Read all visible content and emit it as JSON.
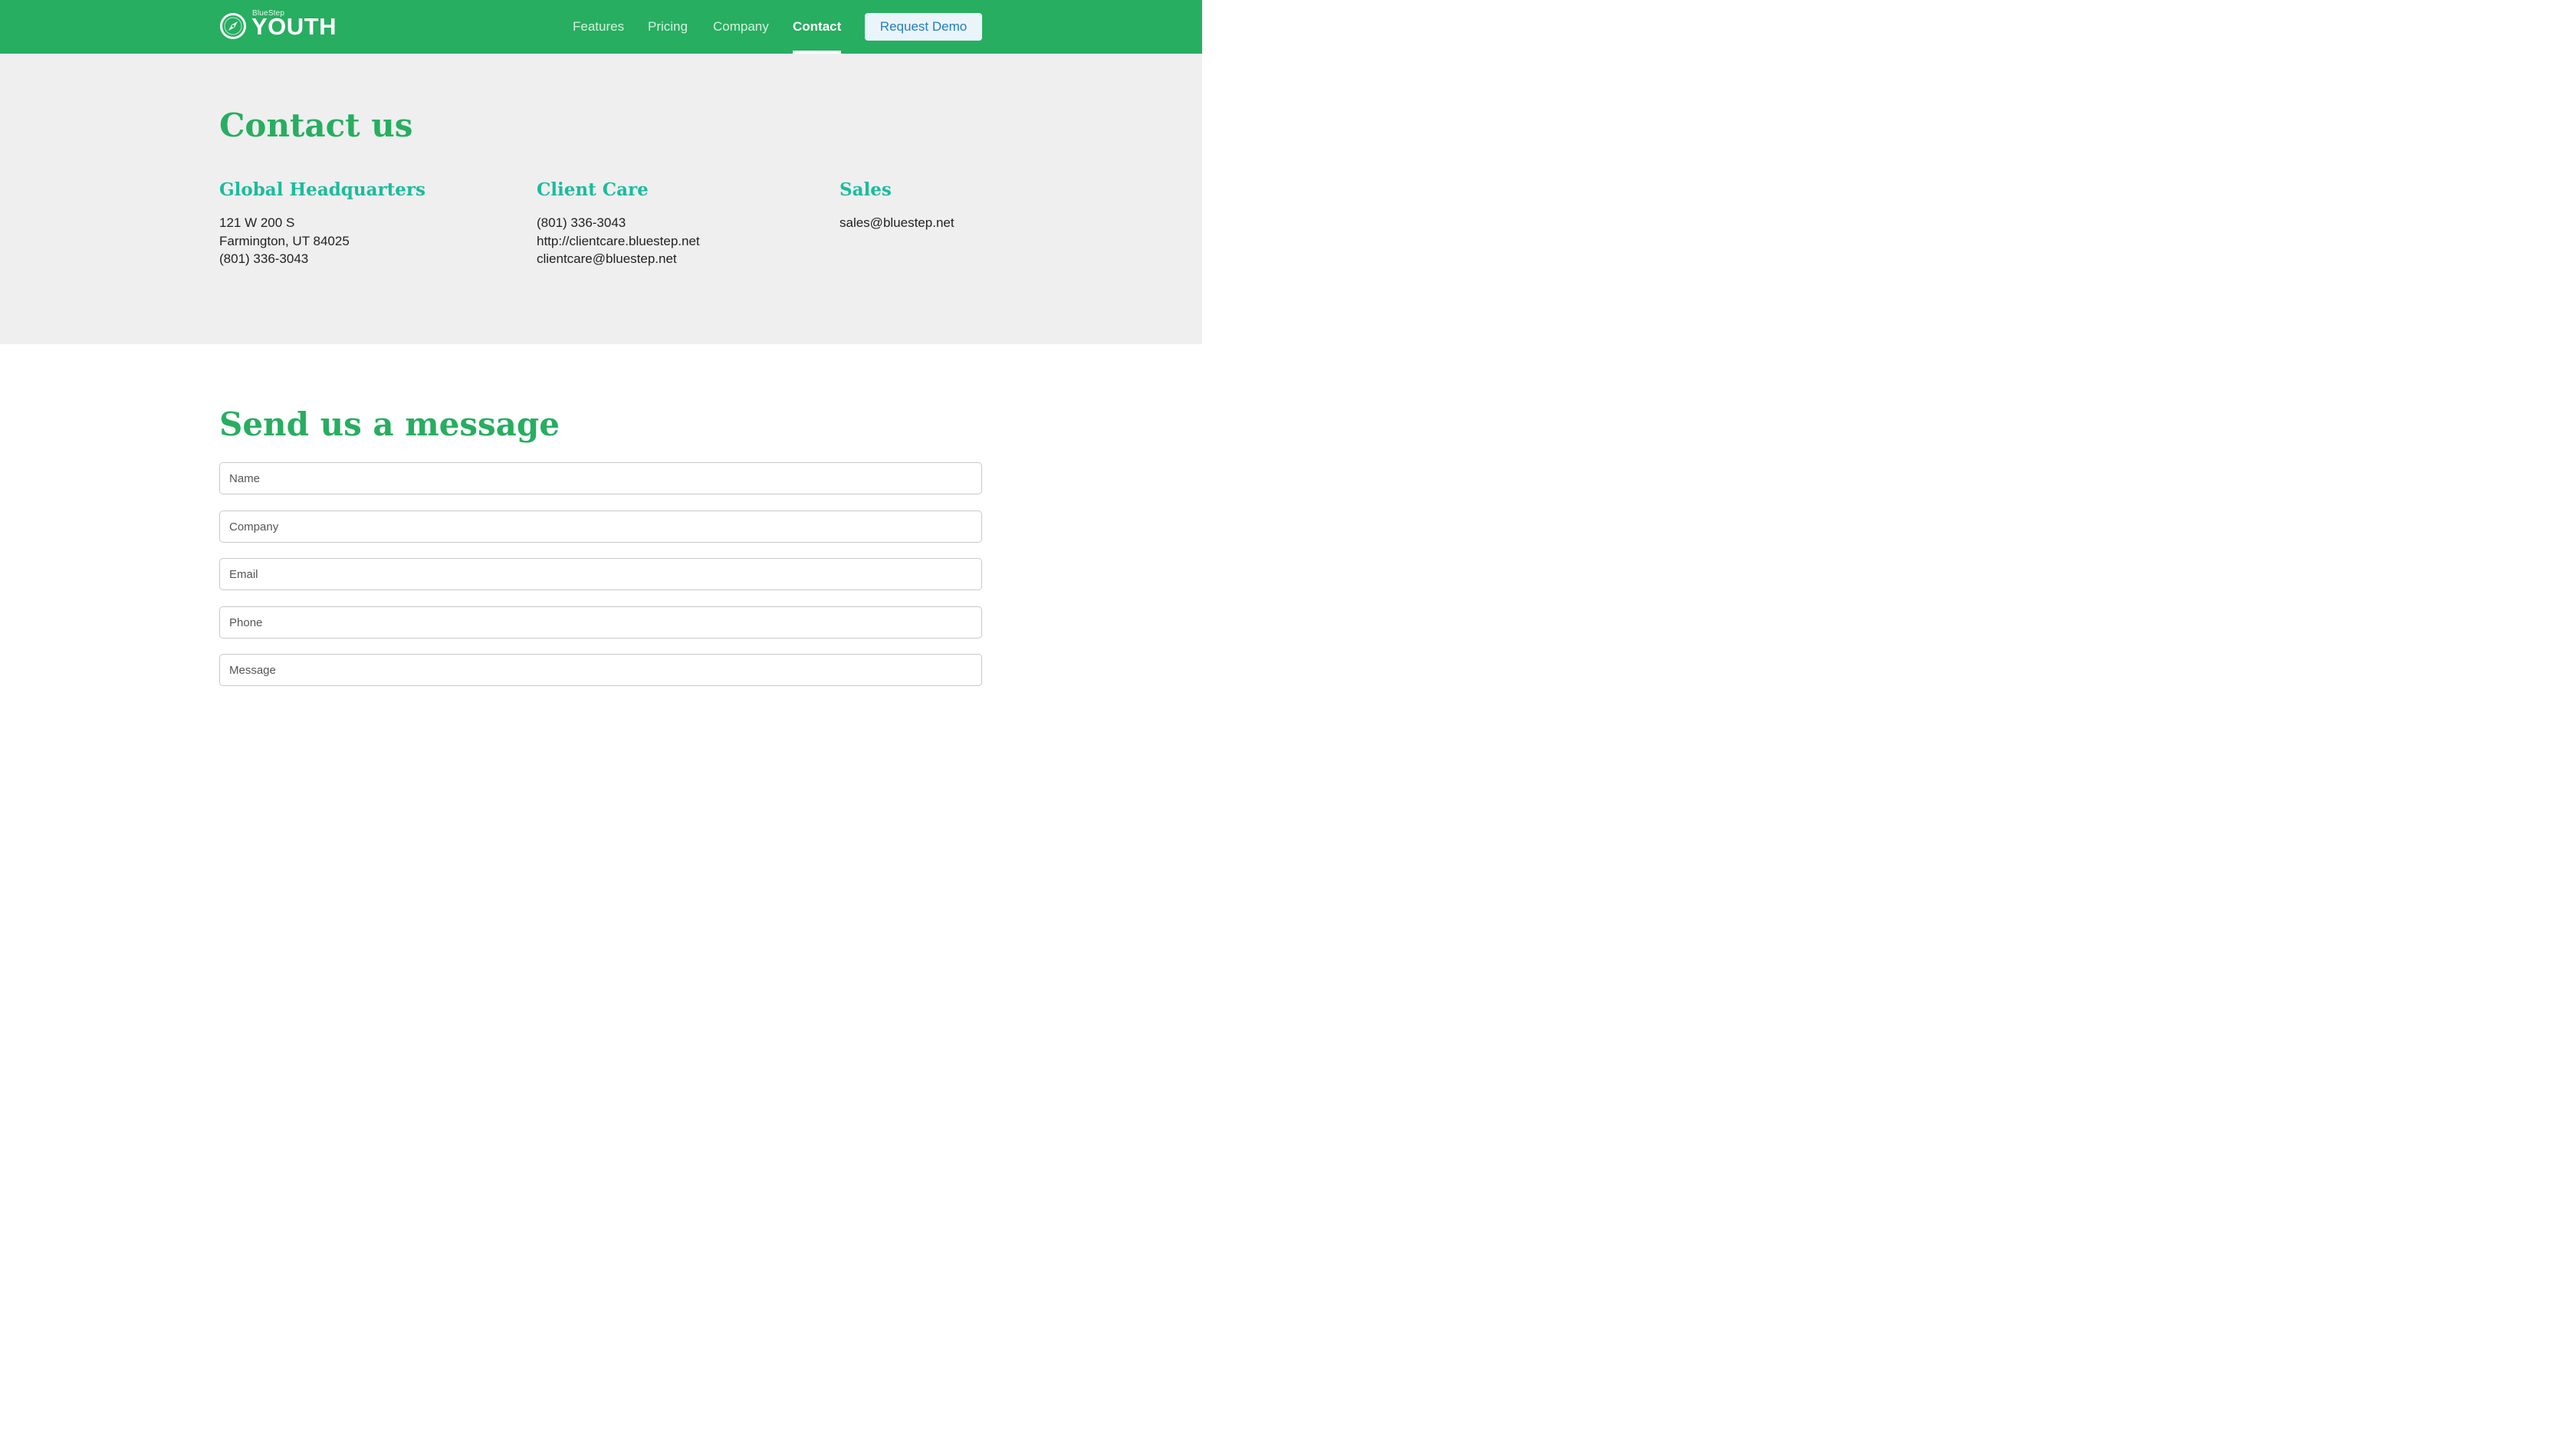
{
  "header": {
    "logo_small": "BlueStep",
    "logo_big": "YOUTH",
    "nav": [
      {
        "label": "Features"
      },
      {
        "label": "Pricing"
      },
      {
        "label": "Company"
      },
      {
        "label": "Contact"
      }
    ],
    "active_nav": "Contact",
    "demo_button": "Request Demo"
  },
  "contact": {
    "title": "Contact us",
    "columns": [
      {
        "title": "Global Headquarters",
        "lines": [
          "121 W 200 S",
          "Farmington, UT 84025",
          "(801) 336-3043"
        ]
      },
      {
        "title": "Client Care",
        "lines": [
          "(801) 336-3043",
          "http://clientcare.bluestep.net",
          "clientcare@bluestep.net"
        ]
      },
      {
        "title": "Sales",
        "lines": [
          "sales@bluestep.net"
        ]
      }
    ]
  },
  "message_form": {
    "title": "Send us a message",
    "fields": [
      {
        "placeholder": "Name"
      },
      {
        "placeholder": "Company"
      },
      {
        "placeholder": "Email"
      },
      {
        "placeholder": "Phone"
      },
      {
        "placeholder": "Message"
      }
    ]
  },
  "colors": {
    "brand_green": "#27ae60",
    "heading_teal": "#1abc9c",
    "button_text_blue": "#1f7fbf",
    "section_gray": "#efefef"
  }
}
